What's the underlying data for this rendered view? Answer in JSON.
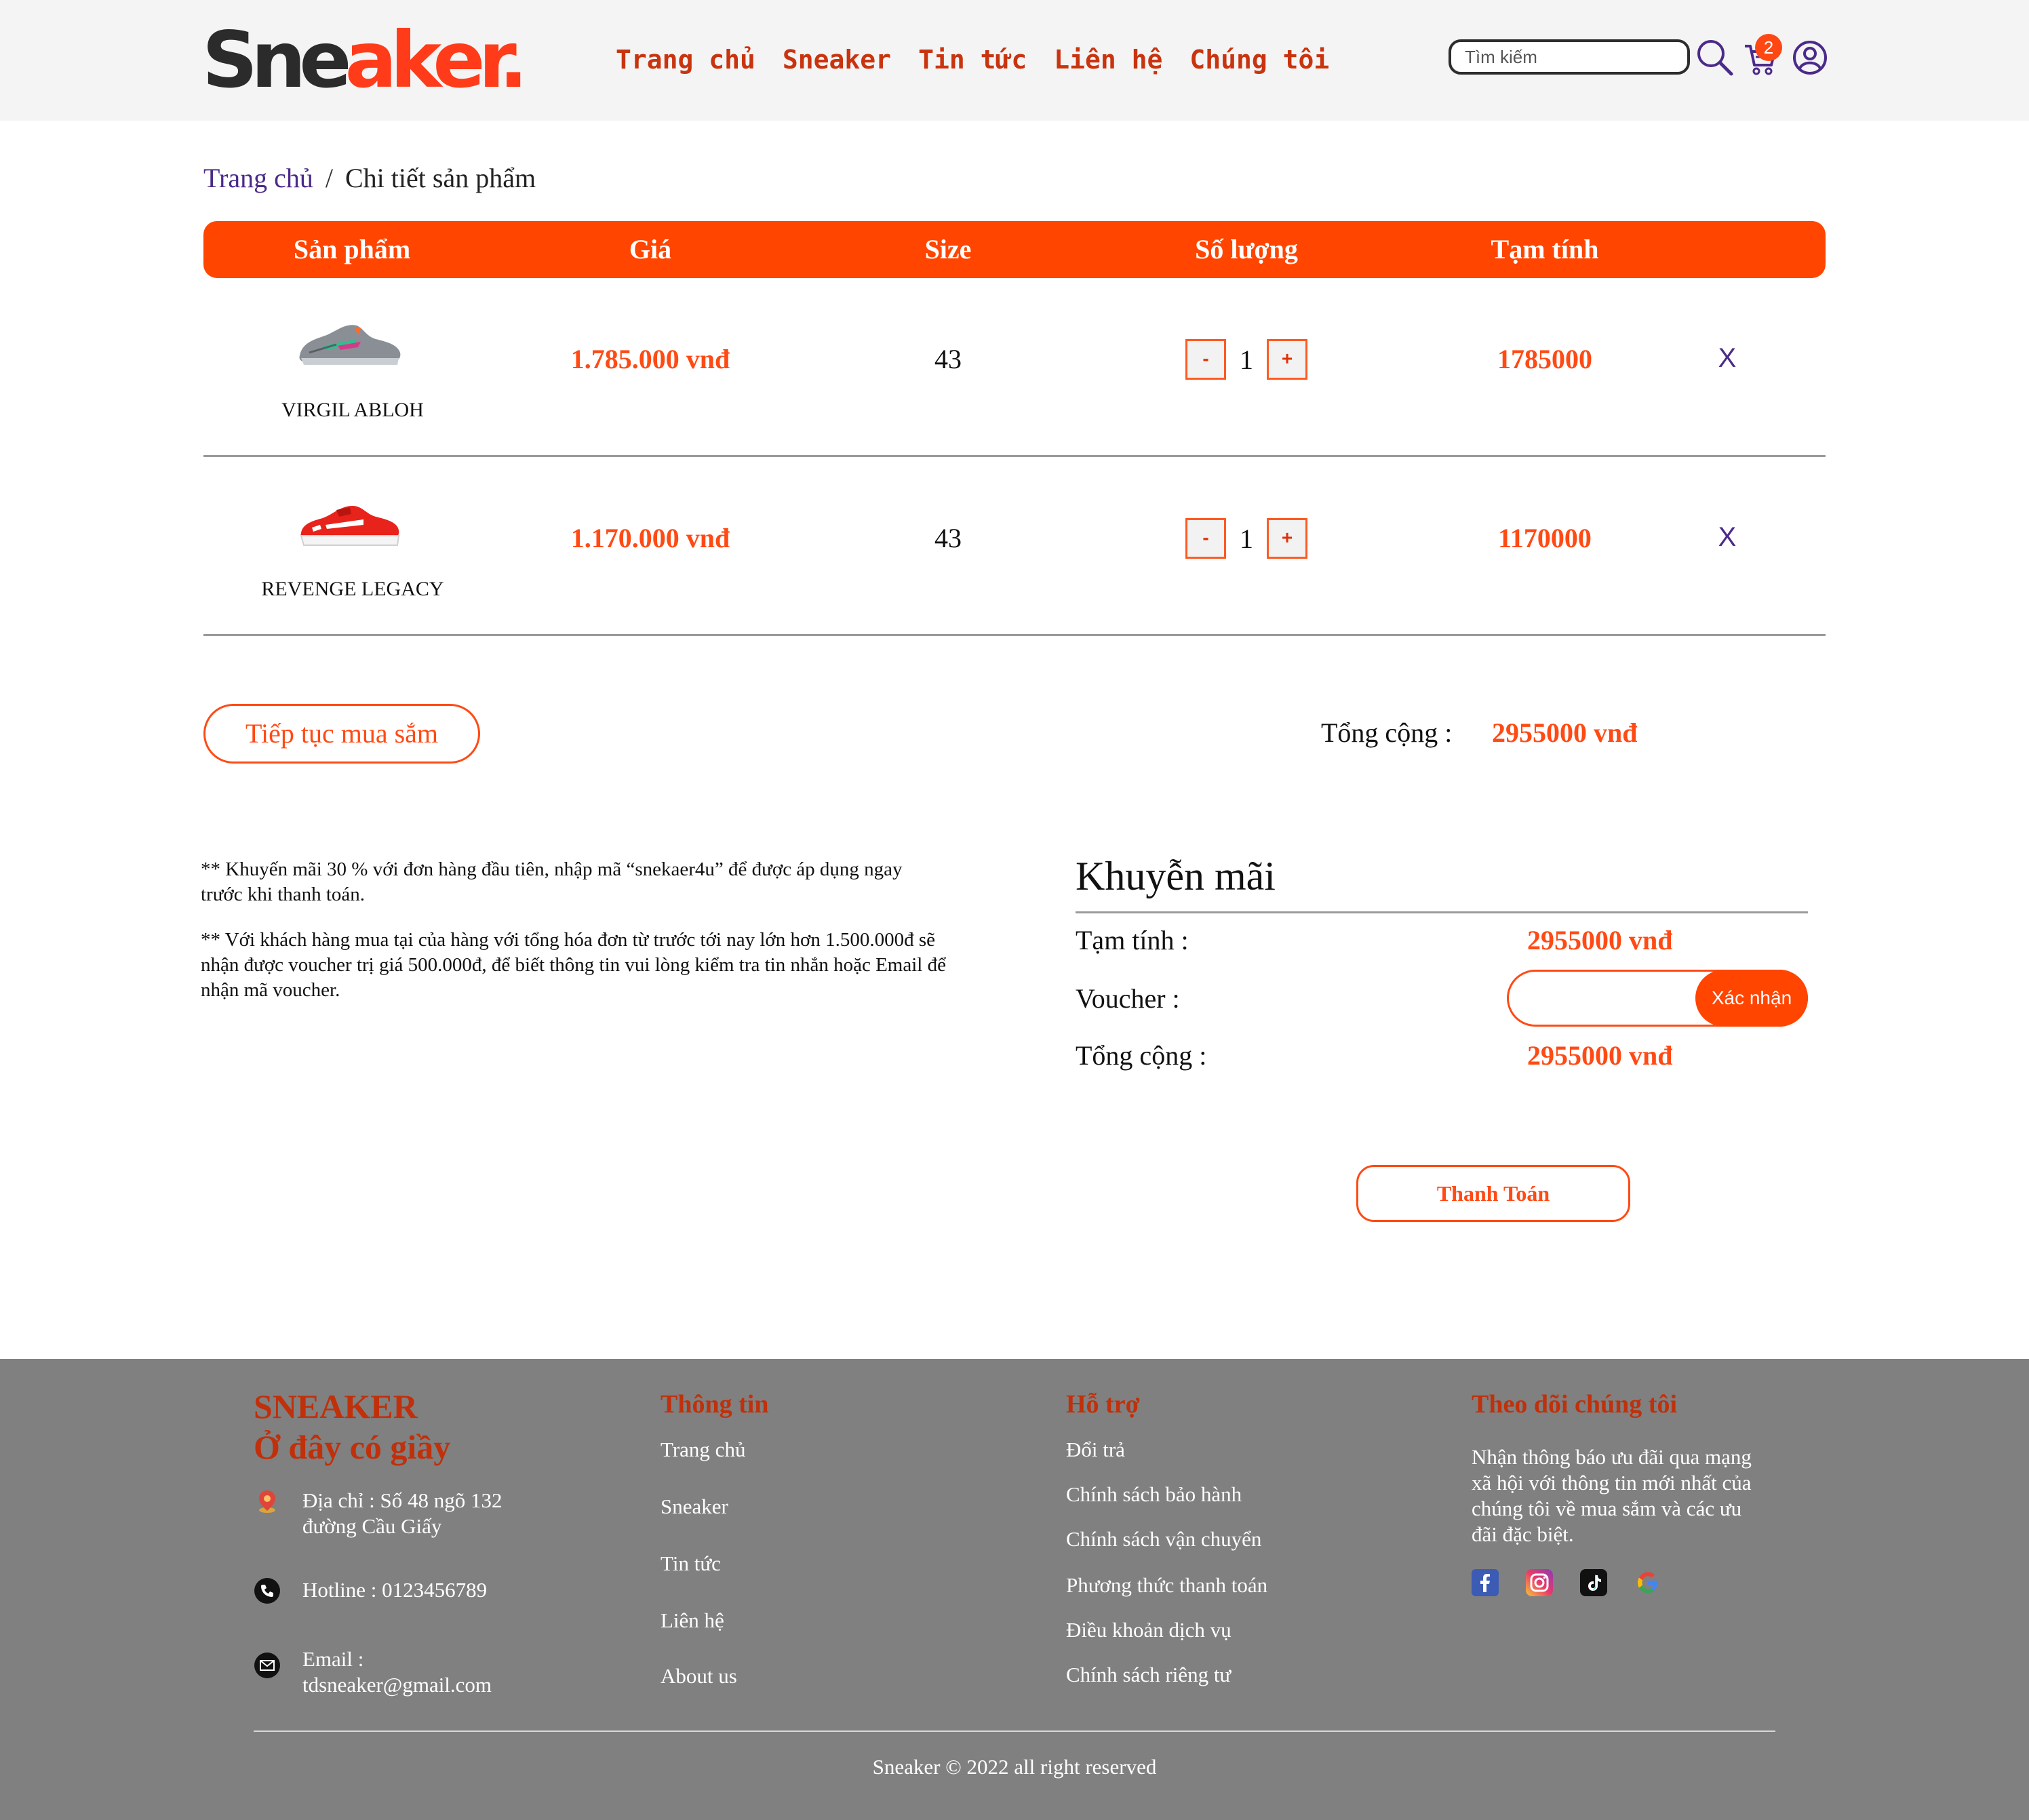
{
  "header": {
    "logo_part1": "Sne",
    "logo_part2": "aker.",
    "nav": [
      "Trang chủ",
      "Sneaker",
      "Tin tức",
      "Liên hệ",
      "Chúng tôi"
    ],
    "search_placeholder": "Tìm kiếm",
    "cart_count": "2",
    "icons": [
      "search-icon",
      "cart-icon",
      "user-icon"
    ]
  },
  "breadcrumb": {
    "home": "Trang chủ",
    "separator": "/",
    "current": "Chi tiết sản phẩm"
  },
  "cart": {
    "columns": [
      "Sản phẩm",
      "Giá",
      "Size",
      "Số lượng",
      "Tạm tính"
    ],
    "items": [
      {
        "name": "VIRGIL ABLOH",
        "price": "1.785.000 vnđ",
        "size": "43",
        "qty": "1",
        "subtotal": "1785000",
        "remove": "X",
        "minus": "-",
        "plus": "+"
      },
      {
        "name": "REVENGE LEGACY",
        "price": "1.170.000 vnđ",
        "size": "43",
        "qty": "1",
        "subtotal": "1170000",
        "remove": "X",
        "minus": "-",
        "plus": "+"
      }
    ],
    "continue_label": "Tiếp tục mua sắm",
    "total_label": "Tổng cộng :",
    "total_value": "2955000 vnđ"
  },
  "notes": [
    "** Khuyến mãi 30 % với đơn hàng đầu tiên, nhập mã “snekaer4u” để được áp dụng ngay trước khi thanh toán.",
    "** Với khách hàng mua tại của hàng với tổng hóa đơn từ trước tới nay lớn hơn 1.500.000đ sẽ nhận được voucher trị giá 500.000đ, để biết thông tin vui lòng kiểm tra tin nhắn hoặc Email để nhận mã voucher."
  ],
  "promo": {
    "title": "Khuyễn mãi",
    "subtotal_label": "Tạm tính :",
    "subtotal_value": "2955000 vnđ",
    "voucher_label": "Voucher :",
    "voucher_value": "",
    "voucher_button": "Xác nhận",
    "total_label": "Tổng cộng :",
    "total_value": "2955000 vnđ",
    "pay_button": "Thanh Toán"
  },
  "footer": {
    "brand_line1": "SNEAKER",
    "brand_line2": "Ở đây có giầy",
    "address": "Địa chỉ : Số 48 ngõ 132 đường Cầu Giấy",
    "hotline": "Hotline : 0123456789",
    "email_label": "Email :",
    "email": "tdsneaker@gmail.com",
    "info_title": "Thông tin",
    "info_links": [
      "Trang chủ",
      "Sneaker",
      "Tin tức",
      "Liên hệ",
      "About us"
    ],
    "support_title": "Hỗ trợ",
    "support_links": [
      "Đổi trả",
      "Chính sách bảo hành",
      "Chính sách vận chuyển",
      "Phương thức thanh toán",
      "Điều khoản dịch vụ",
      "Chính sách riêng tư"
    ],
    "follow_title": "Theo dõi chúng tôi",
    "follow_text": "Nhận thông báo ưu đãi qua mạng xã hội với thông tin mới nhất của chúng tôi về mua sắm và các ưu đãi đặc biệt.",
    "social_icons": [
      "facebook-icon",
      "instagram-icon",
      "tiktok-icon",
      "google-icon"
    ],
    "copyright": "Sneaker © 2022 all right reserved"
  },
  "colors": {
    "accent": "#ff4500",
    "price": "#ff4a14",
    "link_purple": "#4b2a8a",
    "footer_bg": "#808080",
    "footer_title": "#c0300a"
  }
}
